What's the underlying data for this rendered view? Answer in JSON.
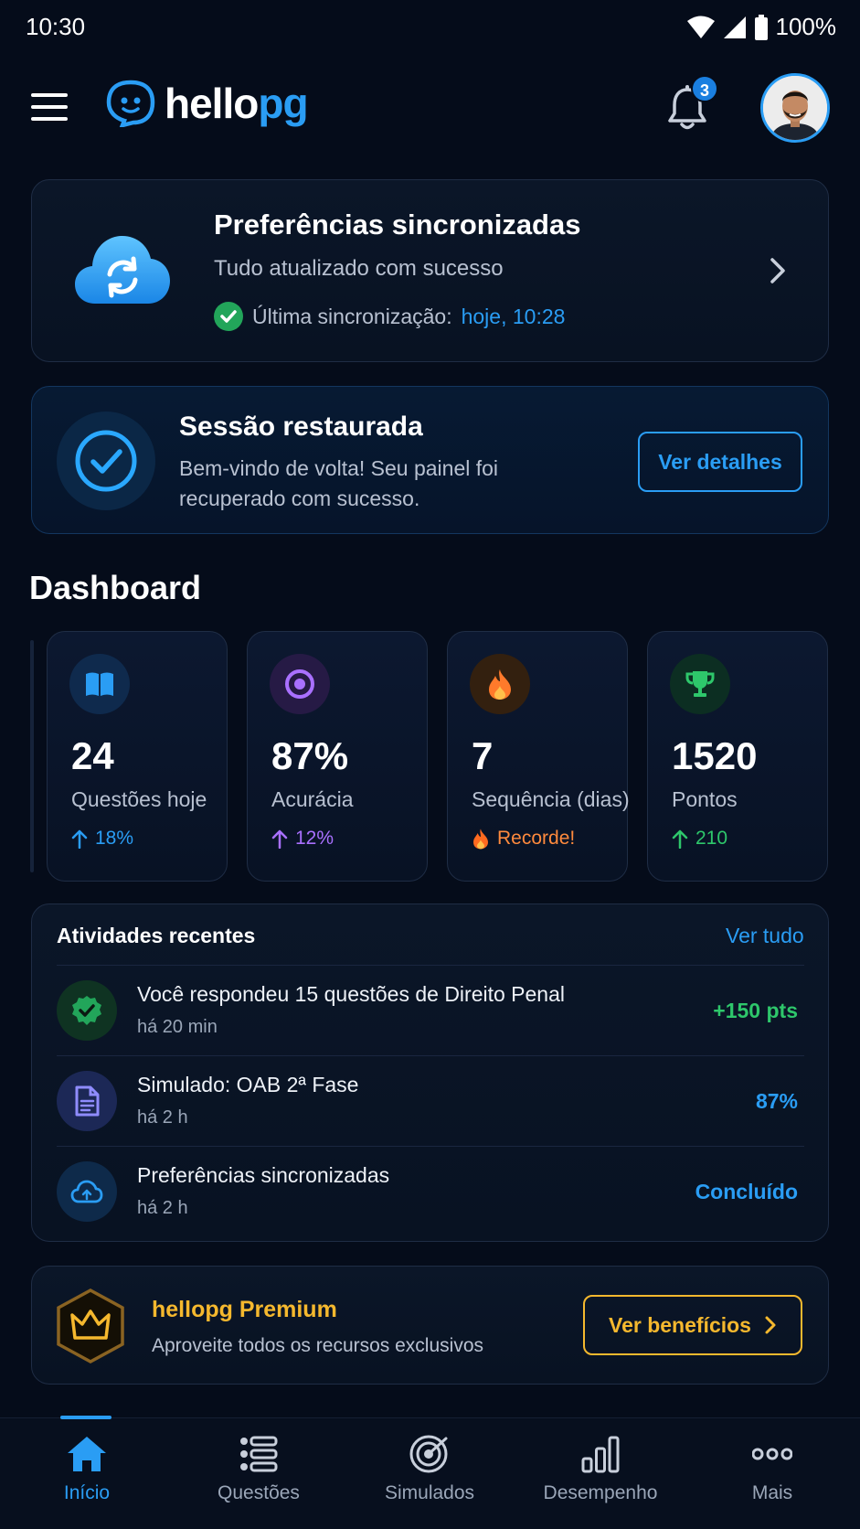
{
  "status_bar": {
    "time": "10:30",
    "battery": "100%"
  },
  "header": {
    "logo_part1": "hello",
    "logo_part2": "pg",
    "notification_count": "3"
  },
  "sync_card": {
    "title": "Preferências sincronizadas",
    "subtitle": "Tudo atualizado com sucesso",
    "last_sync_label": "Última sincronização:",
    "last_sync_time": "hoje, 10:28"
  },
  "session_card": {
    "title": "Sessão restaurada",
    "description": "Bem-vindo de volta! Seu painel foi recuperado com sucesso.",
    "button": "Ver detalhes"
  },
  "dashboard": {
    "title": "Dashboard",
    "stats": [
      {
        "value": "24",
        "label": "Questões hoje",
        "trend": "18%",
        "icon": "book-icon",
        "color": "#2a9df4"
      },
      {
        "value": "87%",
        "label": "Acurácia",
        "trend": "12%",
        "icon": "target-icon",
        "color": "#a970ff"
      },
      {
        "value": "7",
        "label": "Sequência (dias)",
        "trend": "Recorde!",
        "icon": "fire-icon",
        "color": "#ff8a3d"
      },
      {
        "value": "1520",
        "label": "Pontos",
        "trend": "210",
        "icon": "trophy-icon",
        "color": "#2ec76b"
      }
    ]
  },
  "activities": {
    "title": "Atividades recentes",
    "see_all": "Ver tudo",
    "items": [
      {
        "title": "Você respondeu 15 questões de Direito Penal",
        "time": "há 20 min",
        "value": "+150 pts",
        "icon": "check-icon",
        "color": "#2ec76b"
      },
      {
        "title": "Simulado: OAB 2ª Fase",
        "time": "há 2 h",
        "value": "87%",
        "icon": "document-icon",
        "color": "#2a9df4"
      },
      {
        "title": "Preferências sincronizadas",
        "time": "há 2 h",
        "value": "Concluído",
        "icon": "cloud-sync-icon",
        "color": "#2a9df4"
      }
    ]
  },
  "premium": {
    "title": "hellopg Premium",
    "subtitle": "Aproveite todos os recursos exclusivos",
    "button": "Ver benefícios"
  },
  "bottom_nav": {
    "items": [
      {
        "label": "Início",
        "icon": "home-icon",
        "active": true
      },
      {
        "label": "Questões",
        "icon": "list-icon"
      },
      {
        "label": "Simulados",
        "icon": "target-icon"
      },
      {
        "label": "Desempenho",
        "icon": "bar-chart-icon"
      },
      {
        "label": "Mais",
        "icon": "more-icon"
      }
    ]
  }
}
